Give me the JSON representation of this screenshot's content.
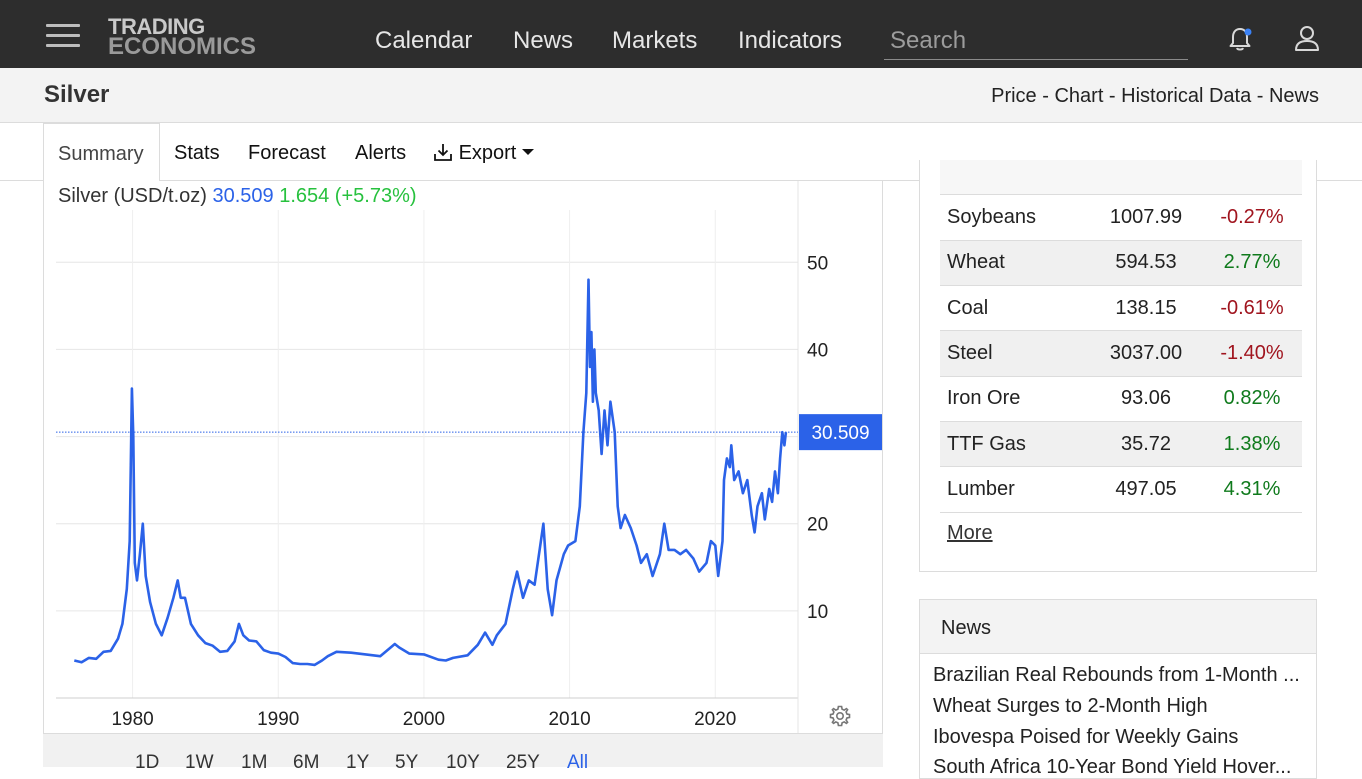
{
  "nav": {
    "logo_line1": "TRADING",
    "logo_line2": "ECONOMICS",
    "links": [
      "Calendar",
      "News",
      "Markets",
      "Indicators"
    ],
    "search_placeholder": "Search"
  },
  "page": {
    "title": "Silver",
    "breadcrumbs": [
      "Price",
      "Chart",
      "Historical Data",
      "News"
    ],
    "breadcrumb_sep": " - "
  },
  "tabs": [
    "Summary",
    "Stats",
    "Forecast",
    "Alerts",
    "Export"
  ],
  "chart_header": {
    "label": "Silver (USD/t.oz)",
    "price": "30.509",
    "change": "1.654 (+5.73%)"
  },
  "chart_data": {
    "type": "line",
    "series": [
      {
        "x": [
          1976,
          1976.5,
          1977,
          1977.5,
          1978,
          1978.5,
          1979,
          1979.3,
          1979.6,
          1979.8,
          1979.95,
          1980.05,
          1980.15,
          1980.3,
          1980.5,
          1980.7,
          1980.9,
          1981.2,
          1981.6,
          1982,
          1982.4,
          1982.8,
          1983.1,
          1983.3,
          1983.6,
          1984,
          1984.5,
          1985,
          1985.5,
          1986,
          1986.5,
          1987,
          1987.3,
          1987.6,
          1988,
          1988.5,
          1989,
          1989.5,
          1990,
          1990.5,
          1991,
          1991.5,
          1992,
          1992.5,
          1993,
          1993.4,
          1994,
          1995,
          1996,
          1997,
          1998,
          1998.3,
          1999,
          2000,
          2001,
          2001.5,
          2002,
          2003,
          2003.7,
          2004.2,
          2004.7,
          2005,
          2005.6,
          2006.1,
          2006.4,
          2006.8,
          2007.2,
          2007.6,
          2008.2,
          2008.5,
          2008.8,
          2009.1,
          2009.6,
          2009.9,
          2010.4,
          2010.7,
          2010.95,
          2011.15,
          2011.3,
          2011.4,
          2011.5,
          2011.6,
          2011.7,
          2011.8,
          2012,
          2012.2,
          2012.4,
          2012.6,
          2012.8,
          2013.1,
          2013.3,
          2013.5,
          2013.8,
          2014.2,
          2014.6,
          2014.9,
          2015.3,
          2015.7,
          2016.2,
          2016.5,
          2016.8,
          2017.2,
          2017.6,
          2018,
          2018.5,
          2018.9,
          2019.4,
          2019.7,
          2020,
          2020.2,
          2020.5,
          2020.6,
          2020.8,
          2021,
          2021.1,
          2021.3,
          2021.6,
          2021.9,
          2022.2,
          2022.5,
          2022.7,
          2022.9,
          2023.2,
          2023.4,
          2023.7,
          2023.9,
          2024.1,
          2024.3,
          2024.45,
          2024.6,
          2024.75,
          2024.85
        ],
        "y": [
          4.3,
          4.1,
          4.6,
          4.5,
          5.3,
          5.4,
          6.8,
          8.5,
          12.5,
          18,
          35.5,
          30,
          15.5,
          13.5,
          16.5,
          20,
          14,
          11,
          8.5,
          7.2,
          9.2,
          11.5,
          13.5,
          11.5,
          11.5,
          8.5,
          7.2,
          6.3,
          6,
          5.3,
          5.4,
          6.5,
          8.5,
          7.2,
          6.6,
          6.5,
          5.5,
          5.2,
          5.1,
          4.7,
          4,
          3.9,
          3.9,
          3.8,
          4.3,
          4.8,
          5.3,
          5.2,
          5,
          4.8,
          6.2,
          5.8,
          5.1,
          5,
          4.4,
          4.3,
          4.6,
          4.9,
          6.1,
          7.5,
          6.1,
          7.2,
          8.5,
          12.5,
          14.5,
          11.5,
          13.5,
          13,
          20,
          12.5,
          9.5,
          13.5,
          16.5,
          17.5,
          18,
          22,
          30.5,
          35,
          48,
          38,
          42,
          34,
          40,
          35,
          33,
          28,
          33,
          29,
          34,
          30.5,
          22,
          19.5,
          21,
          19.5,
          17.5,
          15.5,
          16.5,
          14,
          16.5,
          20,
          17,
          17,
          16.5,
          17,
          16,
          14.5,
          15.5,
          18,
          17.5,
          14,
          18,
          25,
          27.5,
          26.5,
          29,
          25,
          26,
          23.5,
          25,
          21,
          19,
          22,
          23.5,
          20.5,
          24,
          22.5,
          26,
          23.5,
          27.5,
          30.5,
          29,
          30.5
        ]
      }
    ],
    "xlim": [
      1975.6,
      2025.2
    ],
    "ylim": [
      0,
      56
    ],
    "y_ticks": [
      10,
      20,
      30,
      40,
      50
    ],
    "y_tick_labels": [
      "10",
      "20",
      "",
      "40",
      "50"
    ],
    "x_ticks": [
      1980,
      1990,
      2000,
      2010,
      2020
    ],
    "last_value": 30.509,
    "last_value_label": "30.509",
    "line_color": "#2b62e8",
    "grid": true
  },
  "ranges": [
    "1D",
    "1W",
    "1M",
    "6M",
    "1Y",
    "5Y",
    "10Y",
    "25Y",
    "All"
  ],
  "selected_range": "All",
  "commodities": [
    {
      "name": "Soybeans",
      "value": "1007.99",
      "change": "-0.27%",
      "dir": "neg"
    },
    {
      "name": "Wheat",
      "value": "594.53",
      "change": "2.77%",
      "dir": "pos"
    },
    {
      "name": "Coal",
      "value": "138.15",
      "change": "-0.61%",
      "dir": "neg"
    },
    {
      "name": "Steel",
      "value": "3037.00",
      "change": "-1.40%",
      "dir": "neg"
    },
    {
      "name": "Iron Ore",
      "value": "93.06",
      "change": "0.82%",
      "dir": "pos"
    },
    {
      "name": "TTF Gas",
      "value": "35.72",
      "change": "1.38%",
      "dir": "pos"
    },
    {
      "name": "Lumber",
      "value": "497.05",
      "change": "4.31%",
      "dir": "pos"
    }
  ],
  "more_label": "More",
  "news": {
    "heading": "News",
    "items": [
      "Brazilian Real Rebounds from 1-Month ...",
      "Wheat Surges to 2-Month High",
      "Ibovespa Poised for Weekly Gains",
      "South Africa 10-Year Bond Yield Hover..."
    ]
  },
  "colors": {
    "accent": "#2b62e8",
    "up": "#0f7a1c",
    "down": "#a0141e",
    "nav_bg": "#2d2d2d"
  }
}
